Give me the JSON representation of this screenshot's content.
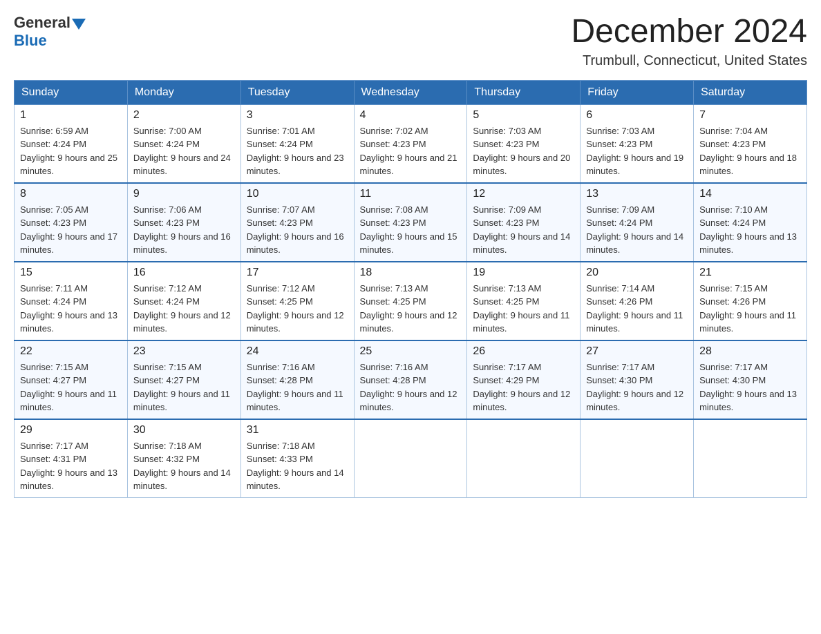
{
  "header": {
    "logo_general": "General",
    "logo_blue": "Blue",
    "month_title": "December 2024",
    "location": "Trumbull, Connecticut, United States"
  },
  "weekdays": [
    "Sunday",
    "Monday",
    "Tuesday",
    "Wednesday",
    "Thursday",
    "Friday",
    "Saturday"
  ],
  "weeks": [
    [
      {
        "day": "1",
        "sunrise": "6:59 AM",
        "sunset": "4:24 PM",
        "daylight": "9 hours and 25 minutes."
      },
      {
        "day": "2",
        "sunrise": "7:00 AM",
        "sunset": "4:24 PM",
        "daylight": "9 hours and 24 minutes."
      },
      {
        "day": "3",
        "sunrise": "7:01 AM",
        "sunset": "4:24 PM",
        "daylight": "9 hours and 23 minutes."
      },
      {
        "day": "4",
        "sunrise": "7:02 AM",
        "sunset": "4:23 PM",
        "daylight": "9 hours and 21 minutes."
      },
      {
        "day": "5",
        "sunrise": "7:03 AM",
        "sunset": "4:23 PM",
        "daylight": "9 hours and 20 minutes."
      },
      {
        "day": "6",
        "sunrise": "7:03 AM",
        "sunset": "4:23 PM",
        "daylight": "9 hours and 19 minutes."
      },
      {
        "day": "7",
        "sunrise": "7:04 AM",
        "sunset": "4:23 PM",
        "daylight": "9 hours and 18 minutes."
      }
    ],
    [
      {
        "day": "8",
        "sunrise": "7:05 AM",
        "sunset": "4:23 PM",
        "daylight": "9 hours and 17 minutes."
      },
      {
        "day": "9",
        "sunrise": "7:06 AM",
        "sunset": "4:23 PM",
        "daylight": "9 hours and 16 minutes."
      },
      {
        "day": "10",
        "sunrise": "7:07 AM",
        "sunset": "4:23 PM",
        "daylight": "9 hours and 16 minutes."
      },
      {
        "day": "11",
        "sunrise": "7:08 AM",
        "sunset": "4:23 PM",
        "daylight": "9 hours and 15 minutes."
      },
      {
        "day": "12",
        "sunrise": "7:09 AM",
        "sunset": "4:23 PM",
        "daylight": "9 hours and 14 minutes."
      },
      {
        "day": "13",
        "sunrise": "7:09 AM",
        "sunset": "4:24 PM",
        "daylight": "9 hours and 14 minutes."
      },
      {
        "day": "14",
        "sunrise": "7:10 AM",
        "sunset": "4:24 PM",
        "daylight": "9 hours and 13 minutes."
      }
    ],
    [
      {
        "day": "15",
        "sunrise": "7:11 AM",
        "sunset": "4:24 PM",
        "daylight": "9 hours and 13 minutes."
      },
      {
        "day": "16",
        "sunrise": "7:12 AM",
        "sunset": "4:24 PM",
        "daylight": "9 hours and 12 minutes."
      },
      {
        "day": "17",
        "sunrise": "7:12 AM",
        "sunset": "4:25 PM",
        "daylight": "9 hours and 12 minutes."
      },
      {
        "day": "18",
        "sunrise": "7:13 AM",
        "sunset": "4:25 PM",
        "daylight": "9 hours and 12 minutes."
      },
      {
        "day": "19",
        "sunrise": "7:13 AM",
        "sunset": "4:25 PM",
        "daylight": "9 hours and 11 minutes."
      },
      {
        "day": "20",
        "sunrise": "7:14 AM",
        "sunset": "4:26 PM",
        "daylight": "9 hours and 11 minutes."
      },
      {
        "day": "21",
        "sunrise": "7:15 AM",
        "sunset": "4:26 PM",
        "daylight": "9 hours and 11 minutes."
      }
    ],
    [
      {
        "day": "22",
        "sunrise": "7:15 AM",
        "sunset": "4:27 PM",
        "daylight": "9 hours and 11 minutes."
      },
      {
        "day": "23",
        "sunrise": "7:15 AM",
        "sunset": "4:27 PM",
        "daylight": "9 hours and 11 minutes."
      },
      {
        "day": "24",
        "sunrise": "7:16 AM",
        "sunset": "4:28 PM",
        "daylight": "9 hours and 11 minutes."
      },
      {
        "day": "25",
        "sunrise": "7:16 AM",
        "sunset": "4:28 PM",
        "daylight": "9 hours and 12 minutes."
      },
      {
        "day": "26",
        "sunrise": "7:17 AM",
        "sunset": "4:29 PM",
        "daylight": "9 hours and 12 minutes."
      },
      {
        "day": "27",
        "sunrise": "7:17 AM",
        "sunset": "4:30 PM",
        "daylight": "9 hours and 12 minutes."
      },
      {
        "day": "28",
        "sunrise": "7:17 AM",
        "sunset": "4:30 PM",
        "daylight": "9 hours and 13 minutes."
      }
    ],
    [
      {
        "day": "29",
        "sunrise": "7:17 AM",
        "sunset": "4:31 PM",
        "daylight": "9 hours and 13 minutes."
      },
      {
        "day": "30",
        "sunrise": "7:18 AM",
        "sunset": "4:32 PM",
        "daylight": "9 hours and 14 minutes."
      },
      {
        "day": "31",
        "sunrise": "7:18 AM",
        "sunset": "4:33 PM",
        "daylight": "9 hours and 14 minutes."
      },
      null,
      null,
      null,
      null
    ]
  ]
}
